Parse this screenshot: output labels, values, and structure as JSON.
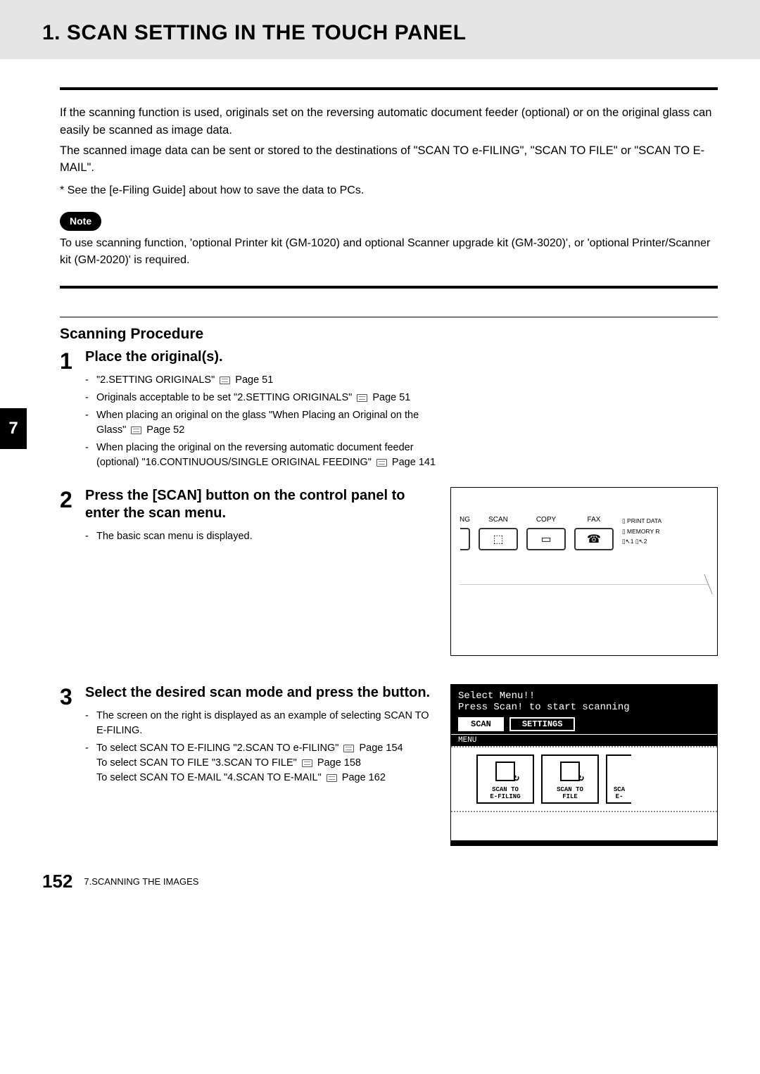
{
  "header": {
    "title": "1. SCAN SETTING IN THE TOUCH PANEL"
  },
  "intro": {
    "p1": "If the scanning function is used, originals set on the reversing automatic document feeder (optional) or on the original glass can easily be scanned as image data.",
    "p2": "The scanned image data can be sent or stored to the destinations of \"SCAN TO e-FILING\", \"SCAN TO FILE\" or \"SCAN TO E-MAIL\".",
    "footnote": "*  See the [e-Filing Guide] about how to save the data to PCs.",
    "note_badge": "Note",
    "note_text": "To use scanning function, 'optional Printer kit (GM-1020) and optional Scanner upgrade kit (GM-3020)', or 'optional Printer/Scanner kit (GM-2020)' is required."
  },
  "chapter_tab": "7",
  "section_heading": "Scanning Procedure",
  "steps": {
    "s1": {
      "num": "1",
      "title": "Place the original(s).",
      "items": {
        "i1a": "\"2.SETTING ORIGINALS\" ",
        "i1b": " Page 51",
        "i2a": "Originals acceptable to be set \"2.SETTING ORIGINALS\" ",
        "i2b": " Page 51",
        "i3a": "When placing an original on the glass \"When Placing an Original on the Glass\" ",
        "i3b": " Page 52",
        "i4a": "When placing the original on the reversing automatic document feeder (optional) \"16.CONTINUOUS/SINGLE ORIGINAL FEEDING\" ",
        "i4b": " Page 141"
      }
    },
    "s2": {
      "num": "2",
      "title": "Press the [SCAN] button on the control panel to enter the scan menu.",
      "items": {
        "i1": "The basic scan menu is displayed."
      },
      "panel": {
        "b0": "NG",
        "b1": "SCAN",
        "b2": "COPY",
        "b3": "FAX",
        "side1": "▯ PRINT DATA",
        "side2": "▯ MEMORY R",
        "side3": "▯↖1 ▯↖2"
      }
    },
    "s3": {
      "num": "3",
      "title": "Select the desired scan mode and press the button.",
      "items": {
        "i1": "The screen on the right is displayed as an example of selecting SCAN TO E-FILING.",
        "i2a": "To select SCAN TO E-FILING \"2.SCAN TO e-FILING\" ",
        "i2b": " Page 154",
        "i2c": "To select SCAN TO FILE \"3.SCAN TO FILE\" ",
        "i2d": " Page 158",
        "i2e": "To select SCAN TO E-MAIL \"4.SCAN TO E-MAIL\" ",
        "i2f": " Page 162"
      },
      "screen": {
        "line1": "Select Menu!!",
        "line2": "Press Scan! to start scanning",
        "tab1": "SCAN",
        "tab2": "SETTINGS",
        "menu_label": "MENU",
        "btn1a": "SCAN TO",
        "btn1b": "E-FILING",
        "btn2a": "SCAN TO",
        "btn2b": "FILE",
        "btn3a": "SCA",
        "btn3b": "E-"
      }
    }
  },
  "footer": {
    "page_num": "152",
    "chapter": "7.SCANNING THE IMAGES"
  }
}
